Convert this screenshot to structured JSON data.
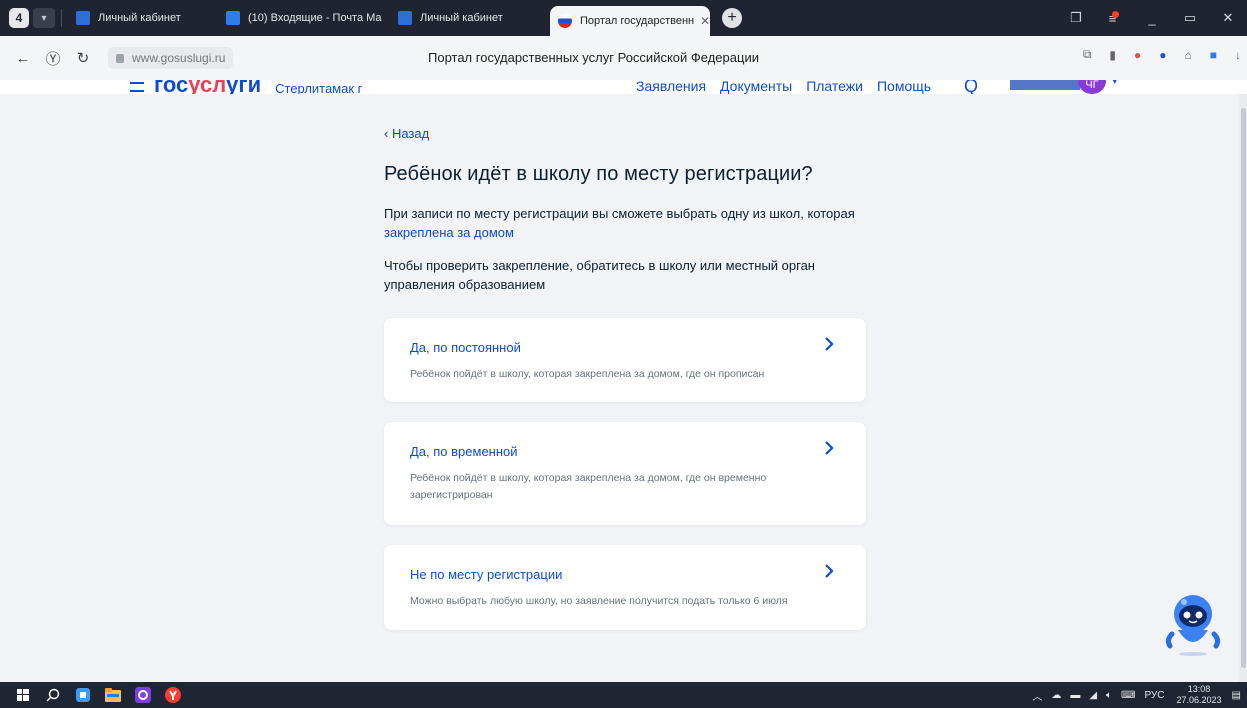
{
  "browser": {
    "tab_counter": "4",
    "tabs": [
      {
        "label": "Личный кабинет",
        "active": false
      },
      {
        "label": "(10) Входящие - Почта Ма",
        "active": false
      },
      {
        "label": "Личный кабинет",
        "active": false
      },
      {
        "label": "Портал государственн",
        "active": true
      }
    ],
    "url": "www.gosuslugi.ru",
    "page_title": "Портал государственных услуг Российской Федерации"
  },
  "site_header": {
    "logo": "госуслуги",
    "city": "Стерлитамак г",
    "nav": [
      "Заявления",
      "Документы",
      "Платежи",
      "Помощь"
    ],
    "avatar_initials": "ЧГ"
  },
  "content": {
    "back_label": "Назад",
    "heading": "Ребёнок идёт в школу по месту регистрации?",
    "intro_text": "При записи по месту регистрации вы сможете выбрать одну из школ, которая",
    "intro_link": "закреплена за домом",
    "check_text": "Чтобы проверить закрепление, обратитесь в школу или местный орган управления образованием",
    "options": [
      {
        "title": "Да, по постоянной",
        "desc": "Ребёнок пойдёт в школу, которая закреплена за домом, где он прописан"
      },
      {
        "title": "Да, по временной",
        "desc": "Ребёнок пойдёт в школу, которая закреплена за домом, где он временно зарегистрирован"
      },
      {
        "title": "Не по месту регистрации",
        "desc": "Можно выбрать любую школу, но заявление получится подать только 6 июля"
      }
    ]
  },
  "taskbar": {
    "lang": "РУС",
    "time": "13:08",
    "date": "27.06.2023"
  },
  "colors": {
    "brand_blue": "#0d4cd3",
    "brand_red": "#ee3f58",
    "page_bg": "#f1f3f6",
    "text_dark": "#0b1f33",
    "text_muted": "#66727f"
  }
}
